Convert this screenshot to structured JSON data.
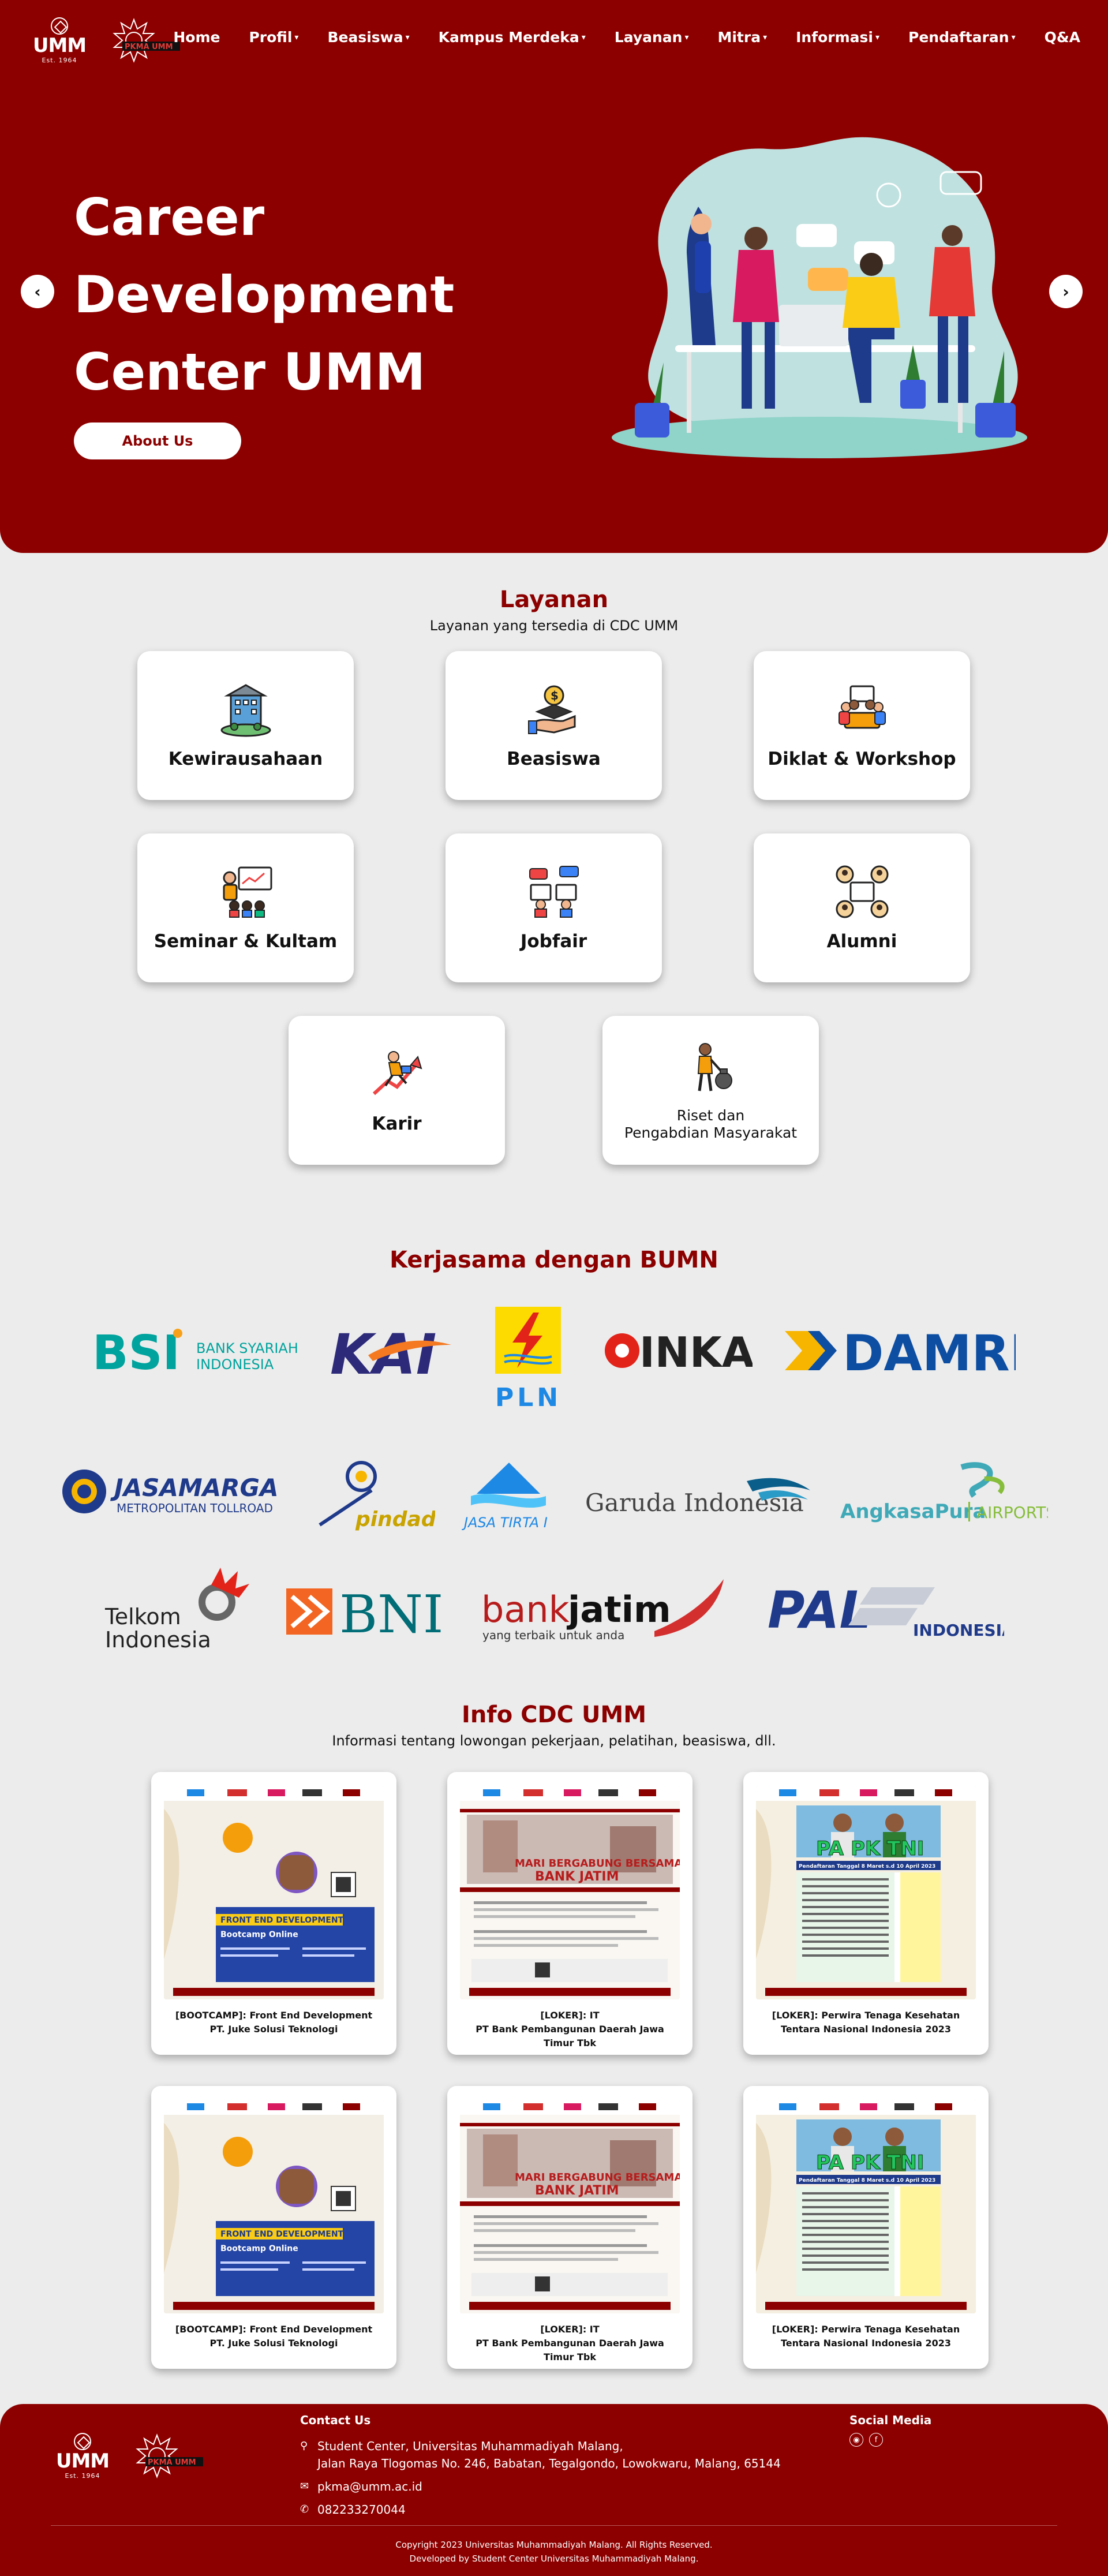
{
  "nav": {
    "logo_text": "UMM",
    "logo_est": "Est. 1964",
    "pkma_text": "PKMA UMM",
    "items": [
      {
        "label": "Home",
        "dropdown": false
      },
      {
        "label": "Profil",
        "dropdown": true
      },
      {
        "label": "Beasiswa",
        "dropdown": true
      },
      {
        "label": "Kampus Merdeka",
        "dropdown": true
      },
      {
        "label": "Layanan",
        "dropdown": true
      },
      {
        "label": "Mitra",
        "dropdown": true
      },
      {
        "label": "Informasi",
        "dropdown": true
      },
      {
        "label": "Pendaftaran",
        "dropdown": true
      },
      {
        "label": "Q&A",
        "dropdown": false
      }
    ]
  },
  "hero": {
    "title_line1": "Career",
    "title_line2": "Development",
    "title_line3": "Center UMM",
    "button_label": "About Us",
    "prev_icon": "chevron-left-icon",
    "next_icon": "chevron-right-icon"
  },
  "layanan": {
    "title": "Layanan",
    "subtitle": "Layanan yang tersedia di CDC UMM",
    "items": [
      {
        "label": "Kewirausahaan",
        "icon": "business-building-icon"
      },
      {
        "label": "Beasiswa",
        "icon": "scholarship-hand-coin-icon"
      },
      {
        "label": "Diklat & Workshop",
        "icon": "workshop-group-icon"
      },
      {
        "label": "Seminar & Kultam",
        "icon": "seminar-presentation-icon"
      },
      {
        "label": "Jobfair",
        "icon": "jobfair-chat-icon"
      },
      {
        "label": "Alumni",
        "icon": "alumni-network-icon"
      },
      {
        "label": "Karir",
        "icon": "career-growth-icon"
      },
      {
        "label": "Riset dan\nPengabdian Masyarakat",
        "line1": "Riset dan",
        "line2": "Pengabdian Masyarakat",
        "icon": "research-person-icon"
      }
    ]
  },
  "bumn": {
    "title": "Kerjasama dengan BUMN",
    "logos": {
      "bsi_main": "BSI",
      "bsi_sub1": "BANK SYARIAH",
      "bsi_sub2": "INDONESIA",
      "kai": "KAI",
      "pln": "PLN",
      "inka": "INKA",
      "damri": "DAMRI",
      "jasamarga_main": "JASAMARGA",
      "jasamarga_sub": "METROPOLITAN TOLLROAD",
      "pindad": "pindad",
      "jasatirta": "JASA TIRTA I",
      "garuda": "Garuda Indonesia",
      "angkasapura_main": "AngkasaPura",
      "angkasapura_sub": "AIRPORTS",
      "telkom_line1": "Telkom",
      "telkom_line2": "Indonesia",
      "bni": "BNI",
      "bankjatim_bank": "bank",
      "bankjatim_jatim": "jatim",
      "bankjatim_tag": "yang terbaik untuk anda",
      "pal_main": "PAL",
      "pal_sub": "INDONESIA"
    }
  },
  "info": {
    "title": "Info CDC UMM",
    "subtitle": "Informasi tentang lowongan pekerjaan, pelatihan, beasiswa, dll.",
    "posts": [
      {
        "line1": "[BOOTCAMP]: Front End Development",
        "line2": "PT. Juke Solusi Teknologi",
        "poster": "bootcamp",
        "poster_title1": "FRONT END DEVELOPMENT",
        "poster_title2": "Bootcamp Online"
      },
      {
        "line1": "[LOKER]: IT",
        "line2": "PT Bank Pembangunan Daerah Jawa Timur Tbk",
        "poster": "bankjatim",
        "poster_title1": "MARI BERGABUNG BERSAMA",
        "poster_title2": "BANK JATIM"
      },
      {
        "line1": "[LOKER]: Perwira Tenaga Kesehatan",
        "line2": "Tentara Nasional Indonesia 2023",
        "poster": "tni",
        "poster_title1": "PA PK TNI",
        "poster_title2": "Pendaftaran Tanggal 8 Maret s.d 10 April 2023"
      },
      {
        "line1": "[BOOTCAMP]: Front End Development",
        "line2": "PT. Juke Solusi Teknologi",
        "poster": "bootcamp",
        "poster_title1": "FRONT END DEVELOPMENT",
        "poster_title2": "Bootcamp Online"
      },
      {
        "line1": "[LOKER]: IT",
        "line2": "PT Bank Pembangunan Daerah Jawa Timur Tbk",
        "poster": "bankjatim",
        "poster_title1": "MARI BERGABUNG BERSAMA",
        "poster_title2": "BANK JATIM"
      },
      {
        "line1": "[LOKER]: Perwira Tenaga Kesehatan",
        "line2": "Tentara Nasional Indonesia 2023",
        "poster": "tni",
        "poster_title1": "PA PK TNI",
        "poster_title2": "Pendaftaran Tanggal 8 Maret s.d 10 April 2023"
      }
    ]
  },
  "footer": {
    "contact_title": "Contact Us",
    "address_line1": "Student Center, Universitas Muhammadiyah Malang,",
    "address_line2": "Jalan Raya Tlogomas No. 246, Babatan, Tegalgondo, Lowokwaru, Malang, 65144",
    "email": "pkma@umm.ac.id",
    "phone": "082233270044",
    "social_title": "Social Media",
    "copyright": "Copyright 2023 Universitas Muhammadiyah Malang. All Rights Reserved.",
    "developed_by": "Developed by Student Center Universitas Muhammadiyah Malang."
  },
  "colors": {
    "brand_red": "#8c0000",
    "background": "#ececec",
    "card": "#ffffff"
  }
}
